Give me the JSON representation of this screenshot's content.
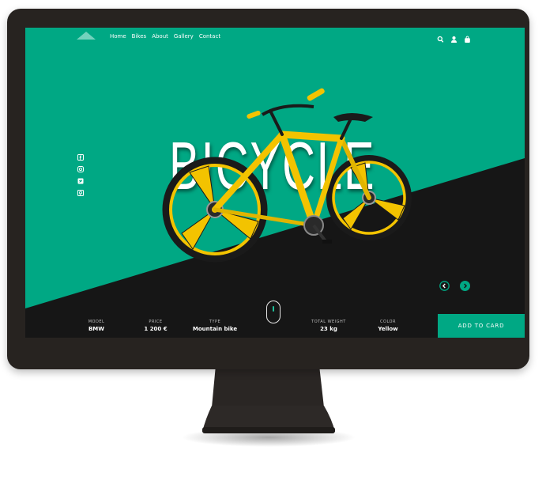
{
  "nav": {
    "logo": "triangle-logo",
    "items": [
      "Home",
      "Bikes",
      "About",
      "Gallery",
      "Contact"
    ],
    "icons": [
      "search-icon",
      "user-icon",
      "shopping-bag-icon"
    ]
  },
  "hero": {
    "headline": "BICYCLE"
  },
  "social": [
    "facebook-icon",
    "instagram-icon",
    "twitter-icon",
    "pinterest-icon"
  ],
  "carousel": {
    "prev": "chevron-left-icon",
    "next": "chevron-right-icon"
  },
  "specs": {
    "model": {
      "label": "MODEL",
      "value": "BMW"
    },
    "price": {
      "label": "PRICE",
      "value": "1 200 €"
    },
    "type": {
      "label": "TYPE",
      "value": "Mountain bike"
    },
    "weight": {
      "label": "TOTAL WEIGHT",
      "value": "23 kg"
    },
    "color": {
      "label": "COLOR",
      "value": "Yellow"
    }
  },
  "cta": {
    "label": "ADD TO CARD"
  },
  "colors": {
    "accent": "#00a884",
    "dark": "#161616",
    "bezel": "#272320",
    "bike": "#f3c300"
  }
}
